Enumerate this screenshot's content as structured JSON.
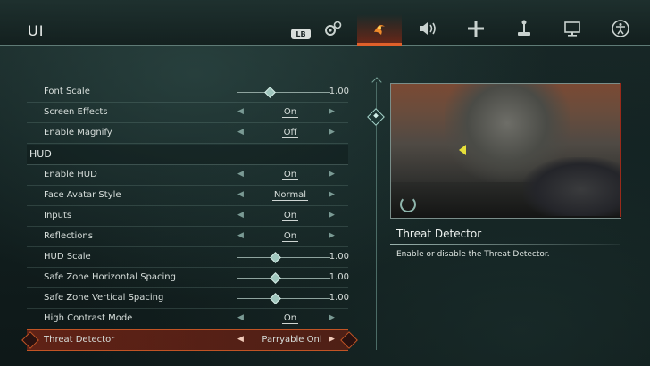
{
  "header": {
    "title": "UI",
    "lb_badge": "LB",
    "tabs": [
      {
        "name": "gameplay",
        "icon": "gears-icon"
      },
      {
        "name": "ui",
        "icon": "ui-emblem-icon",
        "active": true
      },
      {
        "name": "audio",
        "icon": "speaker-icon"
      },
      {
        "name": "controls",
        "icon": "crosshair-plus-icon"
      },
      {
        "name": "mouse-keyboard",
        "icon": "joystick-icon"
      },
      {
        "name": "display",
        "icon": "monitor-icon"
      },
      {
        "name": "accessibility",
        "icon": "accessibility-icon"
      }
    ]
  },
  "settings": {
    "font_scale": {
      "label": "Font Scale",
      "value": "1.00",
      "level": 0.4
    },
    "screen_effects": {
      "label": "Screen Effects",
      "value": "On"
    },
    "enable_magnify": {
      "label": "Enable Magnify",
      "value": "Off"
    },
    "hud_section": "HUD",
    "enable_hud": {
      "label": "Enable HUD",
      "value": "On"
    },
    "face_avatar_style": {
      "label": "Face Avatar Style",
      "value": "Normal"
    },
    "inputs": {
      "label": "Inputs",
      "value": "On"
    },
    "reflections": {
      "label": "Reflections",
      "value": "On"
    },
    "hud_scale": {
      "label": "HUD Scale",
      "value": "1.00",
      "level": 0.4
    },
    "safe_h": {
      "label": "Safe Zone Horizontal Spacing",
      "value": "1.00",
      "level": 0.4
    },
    "safe_v": {
      "label": "Safe Zone Vertical Spacing",
      "value": "1.00",
      "level": 0.4
    },
    "high_contrast": {
      "label": "High Contrast Mode",
      "value": "On"
    },
    "threat_detector": {
      "label": "Threat Detector",
      "value": "Parryable Onl"
    }
  },
  "detail": {
    "title": "Threat Detector",
    "description": "Enable or disable the Threat Detector."
  },
  "colors": {
    "accent": "#e0602a",
    "selected": "#c25425",
    "teal": "#9fc6bd"
  }
}
